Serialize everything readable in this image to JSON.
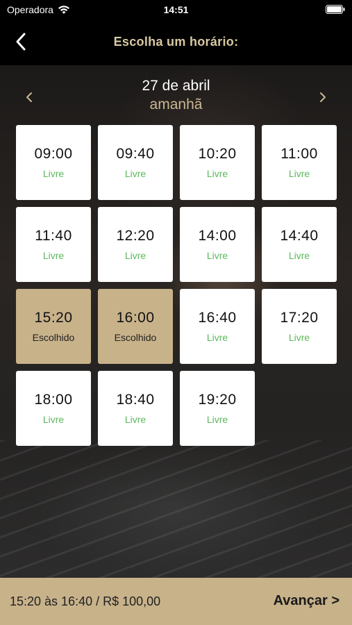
{
  "status_bar": {
    "carrier": "Operadora",
    "time": "14:51"
  },
  "nav": {
    "title": "Escolha um horário:",
    "back_icon": "chevron-left-icon"
  },
  "date": {
    "label": "27 de abril",
    "sub": "amanhã",
    "prev_icon": "chevron-left-icon",
    "next_icon": "chevron-right-icon"
  },
  "slots": [
    {
      "time": "09:00",
      "status": "Livre",
      "selected": false
    },
    {
      "time": "09:40",
      "status": "Livre",
      "selected": false
    },
    {
      "time": "10:20",
      "status": "Livre",
      "selected": false
    },
    {
      "time": "11:00",
      "status": "Livre",
      "selected": false
    },
    {
      "time": "11:40",
      "status": "Livre",
      "selected": false
    },
    {
      "time": "12:20",
      "status": "Livre",
      "selected": false
    },
    {
      "time": "14:00",
      "status": "Livre",
      "selected": false
    },
    {
      "time": "14:40",
      "status": "Livre",
      "selected": false
    },
    {
      "time": "15:20",
      "status": "Escolhido",
      "selected": true
    },
    {
      "time": "16:00",
      "status": "Escolhido",
      "selected": true
    },
    {
      "time": "16:40",
      "status": "Livre",
      "selected": false
    },
    {
      "time": "17:20",
      "status": "Livre",
      "selected": false
    },
    {
      "time": "18:00",
      "status": "Livre",
      "selected": false
    },
    {
      "time": "18:40",
      "status": "Livre",
      "selected": false
    },
    {
      "time": "19:20",
      "status": "Livre",
      "selected": false
    }
  ],
  "footer": {
    "summary": "15:20 às 16:40 / R$ 100,00",
    "advance_label": "Avançar >"
  },
  "colors": {
    "accent": "#c8b28a",
    "title": "#d8c9a3",
    "available": "#5cb85c"
  }
}
